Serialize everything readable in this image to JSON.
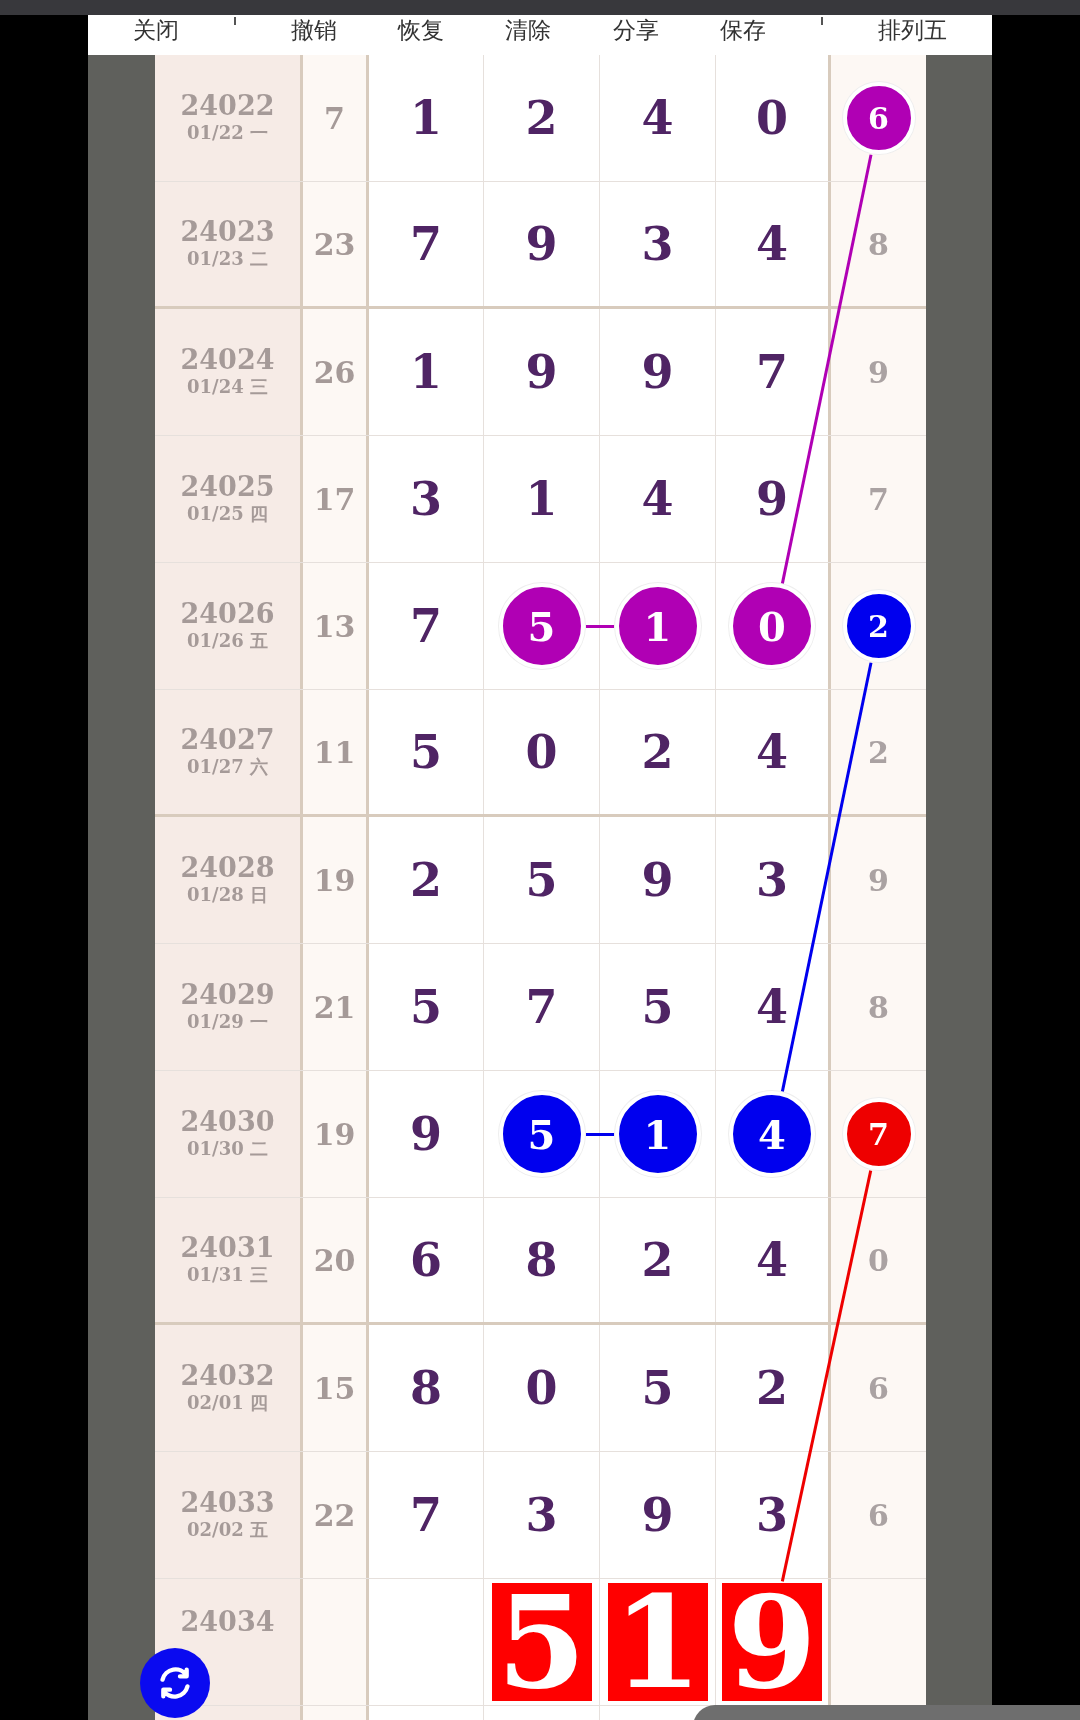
{
  "toolbar": {
    "items": [
      {
        "label": "关闭"
      },
      {
        "label": "撤销"
      },
      {
        "label": "恢复"
      },
      {
        "label": "清除"
      },
      {
        "label": "分享"
      },
      {
        "label": "保存"
      },
      {
        "label": "排列五"
      }
    ]
  },
  "rows": [
    {
      "issue": "24022",
      "date": "01/22 一",
      "sum": "7",
      "numbers": [
        {
          "value": "1"
        },
        {
          "value": "2"
        },
        {
          "value": "4"
        },
        {
          "value": "0"
        }
      ],
      "tail": {
        "value": "6",
        "color": "#b000b4"
      }
    },
    {
      "issue": "24023",
      "date": "01/23 二",
      "sum": "23",
      "numbers": [
        {
          "value": "7"
        },
        {
          "value": "9"
        },
        {
          "value": "3"
        },
        {
          "value": "4"
        }
      ],
      "tail": {
        "value": "8"
      }
    },
    {
      "issue": "24024",
      "date": "01/24 三",
      "sum": "26",
      "numbers": [
        {
          "value": "1"
        },
        {
          "value": "9"
        },
        {
          "value": "9"
        },
        {
          "value": "7"
        }
      ],
      "tail": {
        "value": "9"
      }
    },
    {
      "issue": "24025",
      "date": "01/25 四",
      "sum": "17",
      "numbers": [
        {
          "value": "3"
        },
        {
          "value": "1"
        },
        {
          "value": "4"
        },
        {
          "value": "9"
        }
      ],
      "tail": {
        "value": "7"
      }
    },
    {
      "issue": "24026",
      "date": "01/26 五",
      "sum": "13",
      "numbers": [
        {
          "value": "7"
        },
        {
          "value": "5",
          "color": "#b000b4"
        },
        {
          "value": "1",
          "color": "#b000b4"
        },
        {
          "value": "0",
          "color": "#b000b4"
        }
      ],
      "tail": {
        "value": "2",
        "color": "#0000ee"
      }
    },
    {
      "issue": "24027",
      "date": "01/27 六",
      "sum": "11",
      "numbers": [
        {
          "value": "5"
        },
        {
          "value": "0"
        },
        {
          "value": "2"
        },
        {
          "value": "4"
        }
      ],
      "tail": {
        "value": "2"
      }
    },
    {
      "issue": "24028",
      "date": "01/28 日",
      "sum": "19",
      "numbers": [
        {
          "value": "2"
        },
        {
          "value": "5"
        },
        {
          "value": "9"
        },
        {
          "value": "3"
        }
      ],
      "tail": {
        "value": "9"
      }
    },
    {
      "issue": "24029",
      "date": "01/29 一",
      "sum": "21",
      "numbers": [
        {
          "value": "5"
        },
        {
          "value": "7"
        },
        {
          "value": "5"
        },
        {
          "value": "4"
        }
      ],
      "tail": {
        "value": "8"
      }
    },
    {
      "issue": "24030",
      "date": "01/30 二",
      "sum": "19",
      "numbers": [
        {
          "value": "9"
        },
        {
          "value": "5",
          "color": "#0000ee"
        },
        {
          "value": "1",
          "color": "#0000ee"
        },
        {
          "value": "4",
          "color": "#0000ee"
        }
      ],
      "tail": {
        "value": "7",
        "color": "#ee0000"
      }
    },
    {
      "issue": "24031",
      "date": "01/31 三",
      "sum": "20",
      "numbers": [
        {
          "value": "6"
        },
        {
          "value": "8"
        },
        {
          "value": "2"
        },
        {
          "value": "4"
        }
      ],
      "tail": {
        "value": "0"
      }
    },
    {
      "issue": "24032",
      "date": "02/01 四",
      "sum": "15",
      "numbers": [
        {
          "value": "8"
        },
        {
          "value": "0"
        },
        {
          "value": "5"
        },
        {
          "value": "2"
        }
      ],
      "tail": {
        "value": "6"
      }
    },
    {
      "issue": "24033",
      "date": "02/02 五",
      "sum": "22",
      "numbers": [
        {
          "value": "7"
        },
        {
          "value": "3"
        },
        {
          "value": "9"
        },
        {
          "value": "3"
        }
      ],
      "tail": {
        "value": "6"
      }
    },
    {
      "kind": "result",
      "issue": "24034",
      "numbers": [
        {
          "value": "5",
          "color": "#ff0000"
        },
        {
          "value": "1",
          "color": "#ff0000"
        },
        {
          "value": "9",
          "color": "#ff0000"
        }
      ]
    }
  ]
}
